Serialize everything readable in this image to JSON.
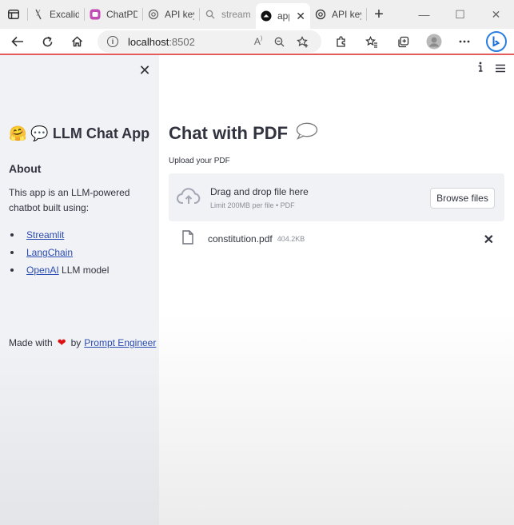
{
  "browser": {
    "tabs": [
      {
        "label": "Excalidra",
        "active": false
      },
      {
        "label": "ChatPDF",
        "active": false
      },
      {
        "label": "API keys",
        "active": false
      },
      {
        "label": "streamli",
        "active": false
      },
      {
        "label": "app",
        "active": true
      },
      {
        "label": "API keys",
        "active": false
      }
    ],
    "new_tab": "+",
    "window_controls": {
      "minimize": "—",
      "maximize": "☐",
      "close": "✕"
    },
    "address": {
      "host": "localhost",
      "port": ":8502"
    }
  },
  "sidebar": {
    "close": "✕",
    "title_emojis": "🤗 💬",
    "title": "LLM Chat App",
    "about_heading": "About",
    "description": "This app is an LLM-powered chatbot built using:",
    "links": [
      {
        "label": "Streamlit",
        "suffix": ""
      },
      {
        "label": "LangChain",
        "suffix": ""
      },
      {
        "label": "OpenAI",
        "suffix": " LLM model"
      }
    ],
    "made_with_prefix": "Made with",
    "heart": "❤",
    "made_with_by": "by",
    "author_link": "Prompt Engineer"
  },
  "main": {
    "title": "Chat with PDF",
    "title_emoji": "💬",
    "upload_label": "Upload your PDF",
    "dropzone": {
      "primary_text": "Drag and drop file here",
      "limit_text": "Limit 200MB per file • PDF",
      "browse_label": "Browse files"
    },
    "file": {
      "name": "constitution.pdf",
      "size": "404.2KB"
    }
  },
  "colors": {
    "accent_link": "#2b4cb0",
    "sidebar_bg": "#f0f2f6",
    "text": "#31333f",
    "heart": "#dd1111"
  }
}
